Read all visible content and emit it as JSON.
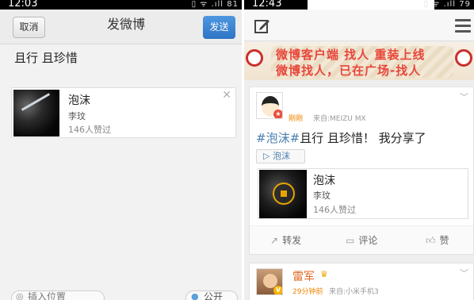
{
  "left": {
    "status_time": "12:03",
    "status_icons": "▯ ᯤ .ıll 81",
    "header": {
      "cancel_label": "取消",
      "title": "发微博",
      "send_label": "发送"
    },
    "compose_text": "且行 且珍惜",
    "share_card": {
      "title": "泡沫",
      "artist": "李玟",
      "likes": "146人赞过",
      "close_icon": "close-icon"
    },
    "footer": {
      "location_label": "插入位置",
      "visibility_label": "公开"
    }
  },
  "right": {
    "status_time": "12:43",
    "status_icons": "▯ ᯤ .ıll 79",
    "header": {
      "compose_icon": "compose-icon",
      "menu_icon": "menu-icon"
    },
    "banner": {
      "line1": "微博客户端 找人 重装上线",
      "line2": "微博找人，已在广场-找人"
    },
    "post": {
      "time": "刚刚",
      "source": "来自:MEIZU MX",
      "tag": "#泡沫#",
      "text": "且行 且珍惜！ 我分享了",
      "tag_button": "▷ 泡沫",
      "card": {
        "title": "泡沫",
        "artist": "李玟",
        "likes": "146人赞过"
      },
      "actions": {
        "repost": "转发",
        "comment": "评论",
        "like": "赞"
      }
    },
    "post2": {
      "name": "雷军",
      "time": "29分钟前",
      "source": "来自:小米手机3"
    }
  },
  "colors": {
    "send_blue": "#2e74c5",
    "accent_orange": "#f08300",
    "link_blue": "#4a7fb0",
    "banner_red": "#e8463a"
  }
}
